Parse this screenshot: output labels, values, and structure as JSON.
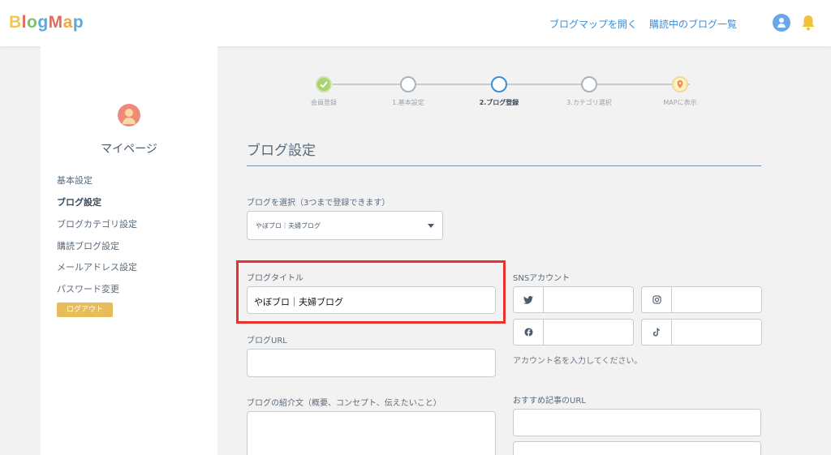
{
  "header": {
    "logo_letters": [
      "B",
      "l",
      "o",
      "g",
      "M",
      "a",
      "p"
    ],
    "logo_colors": [
      "#f2c84b",
      "#e86a5a",
      "#7bc267",
      "#5aa8e0",
      "#e86a5a",
      "#f2a93b",
      "#5aa8e0"
    ],
    "nav_open_map": "ブログマップを開く",
    "nav_subscribed": "購読中のブログ一覧",
    "icons": [
      "user-icon",
      "bell-icon"
    ]
  },
  "sidebar": {
    "title": "マイページ",
    "items": [
      {
        "label": "基本設定",
        "active": false
      },
      {
        "label": "ブログ設定",
        "active": true
      },
      {
        "label": "ブログカテゴリ設定",
        "active": false
      },
      {
        "label": "購読ブログ設定",
        "active": false
      },
      {
        "label": "メールアドレス設定",
        "active": false
      },
      {
        "label": "パスワード変更",
        "active": false
      }
    ],
    "logout": "ログアウト"
  },
  "steps": [
    {
      "label": "会員登録",
      "state": "done"
    },
    {
      "label": "1.基本設定",
      "state": "todo"
    },
    {
      "label": "2.ブログ登録",
      "state": "current"
    },
    {
      "label": "3.カテゴリ選択",
      "state": "todo"
    },
    {
      "label": "MAPに表示",
      "state": "map"
    }
  ],
  "form": {
    "section_title": "ブログ設定",
    "select_label": "ブログを選択（3つまで登録できます）",
    "select_value": "やぼブロ｜夫婦ブログ",
    "blog_title_label": "ブログタイトル",
    "blog_title_value": "やぼブロ｜夫婦ブログ",
    "blog_url_label": "ブログURL",
    "blog_url_value": "",
    "intro_label": "ブログの紹介文（概要、コンセプト、伝えたいこと）",
    "intro_value": "",
    "sns_label": "SNSアカウント",
    "sns_accounts": [
      {
        "icon": "twitter-icon",
        "value": ""
      },
      {
        "icon": "instagram-icon",
        "value": ""
      },
      {
        "icon": "facebook-icon",
        "value": ""
      },
      {
        "icon": "tiktok-icon",
        "value": ""
      }
    ],
    "sns_hint": "アカウント名を入力してください。",
    "recommended_label": "おすすめ記事のURL",
    "recommended_values": [
      "",
      ""
    ]
  },
  "colors": {
    "accent": "#3b8fd6",
    "logout": "#e6bd5a",
    "highlight": "#e8302e"
  }
}
